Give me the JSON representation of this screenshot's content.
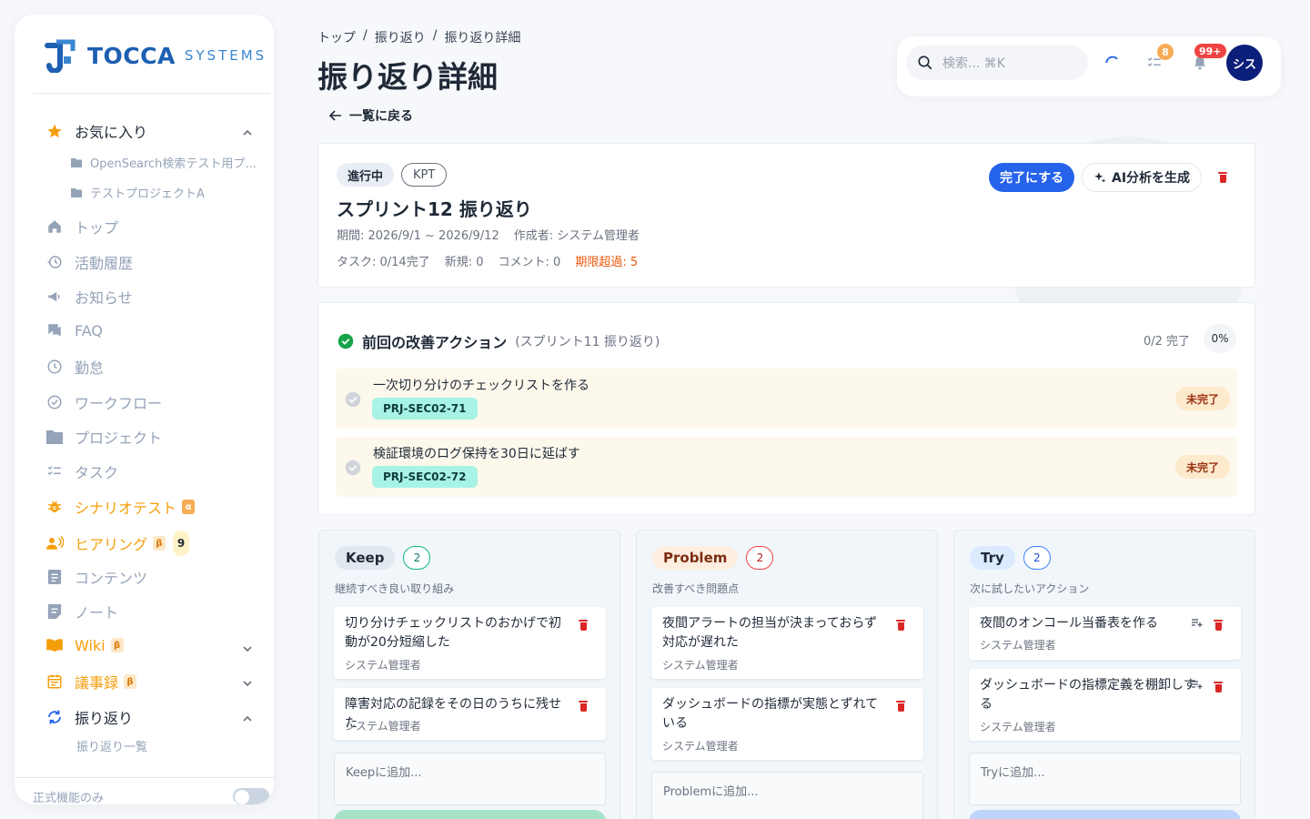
{
  "brand": {
    "name": "TOCCA",
    "sub": "SYSTEMS"
  },
  "sidebar": {
    "favorites": {
      "label": "お気に入り",
      "items": [
        "OpenSearch検索テスト用プ...",
        "テストプロジェクトA"
      ]
    },
    "items": [
      {
        "label": "トップ",
        "icon": "home-icon"
      },
      {
        "label": "活動履歴",
        "icon": "history-icon"
      },
      {
        "label": "お知らせ",
        "icon": "megaphone-icon"
      },
      {
        "label": "FAQ",
        "icon": "chat-icon"
      },
      {
        "label": "勤怠",
        "icon": "clock-icon"
      },
      {
        "label": "ワークフロー",
        "icon": "check-circle-icon"
      },
      {
        "label": "プロジェクト",
        "icon": "folder-icon"
      },
      {
        "label": "タスク",
        "icon": "checklist-icon"
      },
      {
        "label": "シナリオテスト",
        "icon": "bug-icon",
        "badge": "α"
      },
      {
        "label": "ヒアリング",
        "icon": "people-icon",
        "badge": "β",
        "count": "9"
      },
      {
        "label": "コンテンツ",
        "icon": "document-icon"
      },
      {
        "label": "ノート",
        "icon": "note-icon"
      },
      {
        "label": "Wiki",
        "icon": "book-icon",
        "badge": "β"
      },
      {
        "label": "議事録",
        "icon": "calendar-icon",
        "badge": "β"
      },
      {
        "label": "振り返り",
        "icon": "refresh-icon"
      }
    ],
    "retro_sub": {
      "label": "振り返り一覧"
    },
    "footer": {
      "label": "正式機能のみ"
    }
  },
  "breadcrumb": [
    "トップ",
    "振り返り",
    "振り返り詳細"
  ],
  "breadcrumb_sep": "/",
  "page_title": "振り返り詳細",
  "back_label": "一覧に戻る",
  "header": {
    "search_placeholder": "検索... ⌘K",
    "task_badge": "8",
    "notif_badge": "99+",
    "avatar": "シス"
  },
  "retro": {
    "status": "進行中",
    "format": "KPT",
    "title": "スプリント12 振り返り",
    "period": "期間: 2026/9/1 ~ 2026/9/12",
    "author": "作成者: システム管理者",
    "stats": {
      "tasks": "タスク: 0/14完了",
      "new": "新規: 0",
      "comments": "コメント: 0",
      "overdue": "期限超過: 5"
    },
    "complete_button": "完了にする",
    "ai_button": "AI分析を生成"
  },
  "prev_actions": {
    "title": "前回の改善アクション",
    "source": "(スプリント11 振り返り)",
    "progress": "0/2 完了",
    "percent": "0%",
    "items": [
      {
        "text": "一次切り分けのチェックリストを作る",
        "tag": "PRJ-SEC02-71",
        "status": "未完了"
      },
      {
        "text": "検証環境のログ保持を30日に延ばす",
        "tag": "PRJ-SEC02-72",
        "status": "未完了"
      }
    ]
  },
  "columns": {
    "keep": {
      "title": "Keep",
      "count": "2",
      "desc": "継続すべき良い取り組み",
      "items": [
        {
          "text": "切り分けチェックリストのおかげで初動が20分短縮した",
          "by": "システム管理者"
        },
        {
          "text": "障害対応の記録をその日のうちに残せた",
          "by": "システム管理者"
        }
      ],
      "placeholder": "Keepに追加..."
    },
    "problem": {
      "title": "Problem",
      "count": "2",
      "desc": "改善すべき問題点",
      "items": [
        {
          "text": "夜間アラートの担当が決まっておらず対応が遅れた",
          "by": "システム管理者"
        },
        {
          "text": "ダッシュボードの指標が実態とずれている",
          "by": "システム管理者"
        }
      ],
      "placeholder": "Problemに追加..."
    },
    "try": {
      "title": "Try",
      "count": "2",
      "desc": "次に試したいアクション",
      "items": [
        {
          "text": "夜間のオンコール当番表を作る",
          "by": "システム管理者"
        },
        {
          "text": "ダッシュボードの指標定義を棚卸しする",
          "by": "システム管理者"
        }
      ],
      "placeholder": "Tryに追加..."
    }
  },
  "colors": {
    "primary": "#2563eb",
    "orange": "#f59e0b",
    "danger": "#dc2626",
    "avatar": "#0b1e79"
  }
}
